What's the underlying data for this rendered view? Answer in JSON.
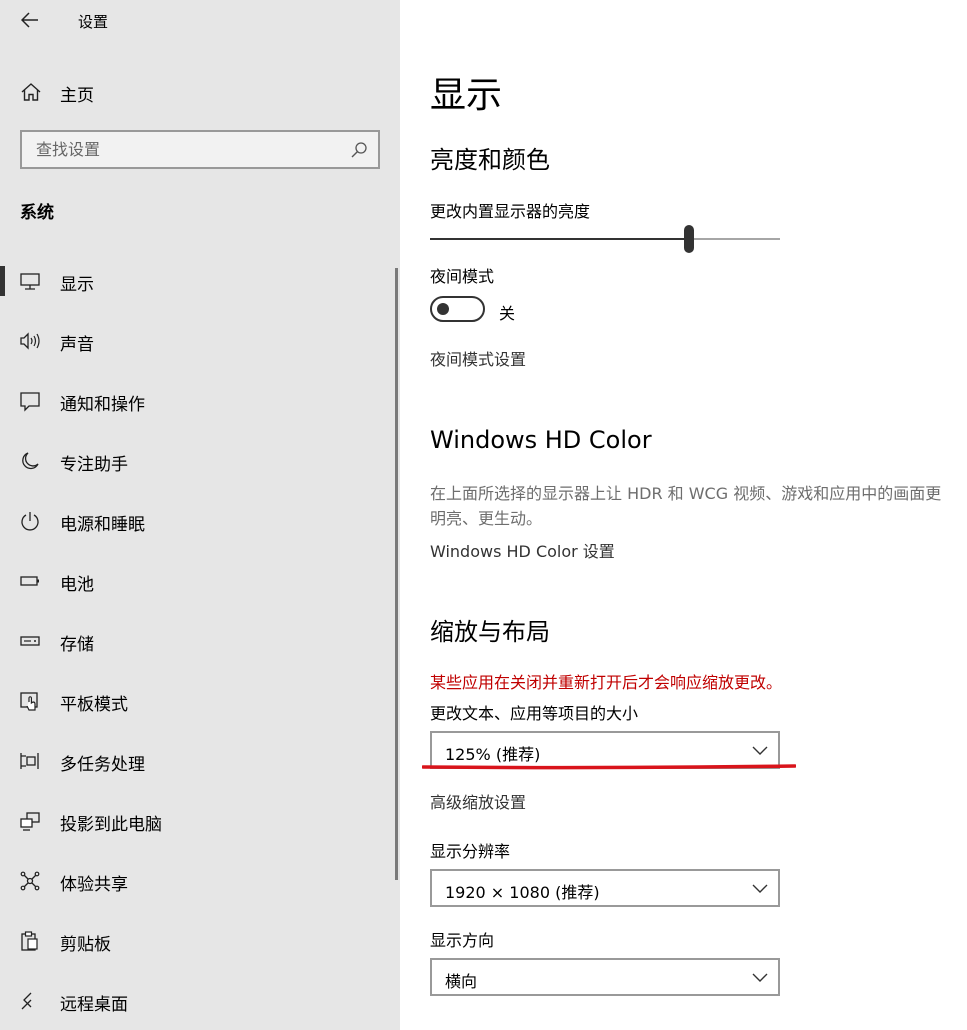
{
  "window": {
    "title": "设置"
  },
  "sidebar": {
    "home_label": "主页",
    "search_placeholder": "查找设置",
    "section": "系统",
    "items": [
      {
        "label": "显示",
        "icon": "monitor-icon",
        "active": true
      },
      {
        "label": "声音",
        "icon": "speaker-icon"
      },
      {
        "label": "通知和操作",
        "icon": "notification-icon"
      },
      {
        "label": "专注助手",
        "icon": "moon-icon"
      },
      {
        "label": "电源和睡眠",
        "icon": "power-icon"
      },
      {
        "label": "电池",
        "icon": "battery-icon"
      },
      {
        "label": "存储",
        "icon": "storage-icon"
      },
      {
        "label": "平板模式",
        "icon": "tablet-mode-icon"
      },
      {
        "label": "多任务处理",
        "icon": "multitasking-icon"
      },
      {
        "label": "投影到此电脑",
        "icon": "project-icon"
      },
      {
        "label": "体验共享",
        "icon": "shared-experiences-icon"
      },
      {
        "label": "剪贴板",
        "icon": "clipboard-icon"
      },
      {
        "label": "远程桌面",
        "icon": "remote-desktop-icon"
      }
    ]
  },
  "main": {
    "title": "显示",
    "brightness": {
      "heading": "亮度和颜色",
      "label": "更改内置显示器的亮度",
      "value_percent": 74
    },
    "night_light": {
      "label": "夜间模式",
      "state": "关",
      "settings_link": "夜间模式设置"
    },
    "hd_color": {
      "heading": "Windows HD Color",
      "desc_line1": "在上面所选择的显示器上让 HDR 和 WCG 视频、游戏和应用中的画面更",
      "desc_line2": "明亮、更生动。",
      "settings_link": "Windows HD Color 设置"
    },
    "scale": {
      "heading": "缩放与布局",
      "warning": "某些应用在关闭并重新打开后才会响应缩放更改。",
      "size_label": "更改文本、应用等项目的大小",
      "size_value": "125% (推荐)",
      "advanced_link": "高级缩放设置",
      "resolution_label": "显示分辨率",
      "resolution_value": "1920 × 1080 (推荐)",
      "orientation_label": "显示方向",
      "orientation_value": "横向"
    }
  },
  "colors": {
    "annotation_red": "#d9141b",
    "warning_red": "#c00000",
    "sidebar_bg": "#e6e6e6"
  }
}
